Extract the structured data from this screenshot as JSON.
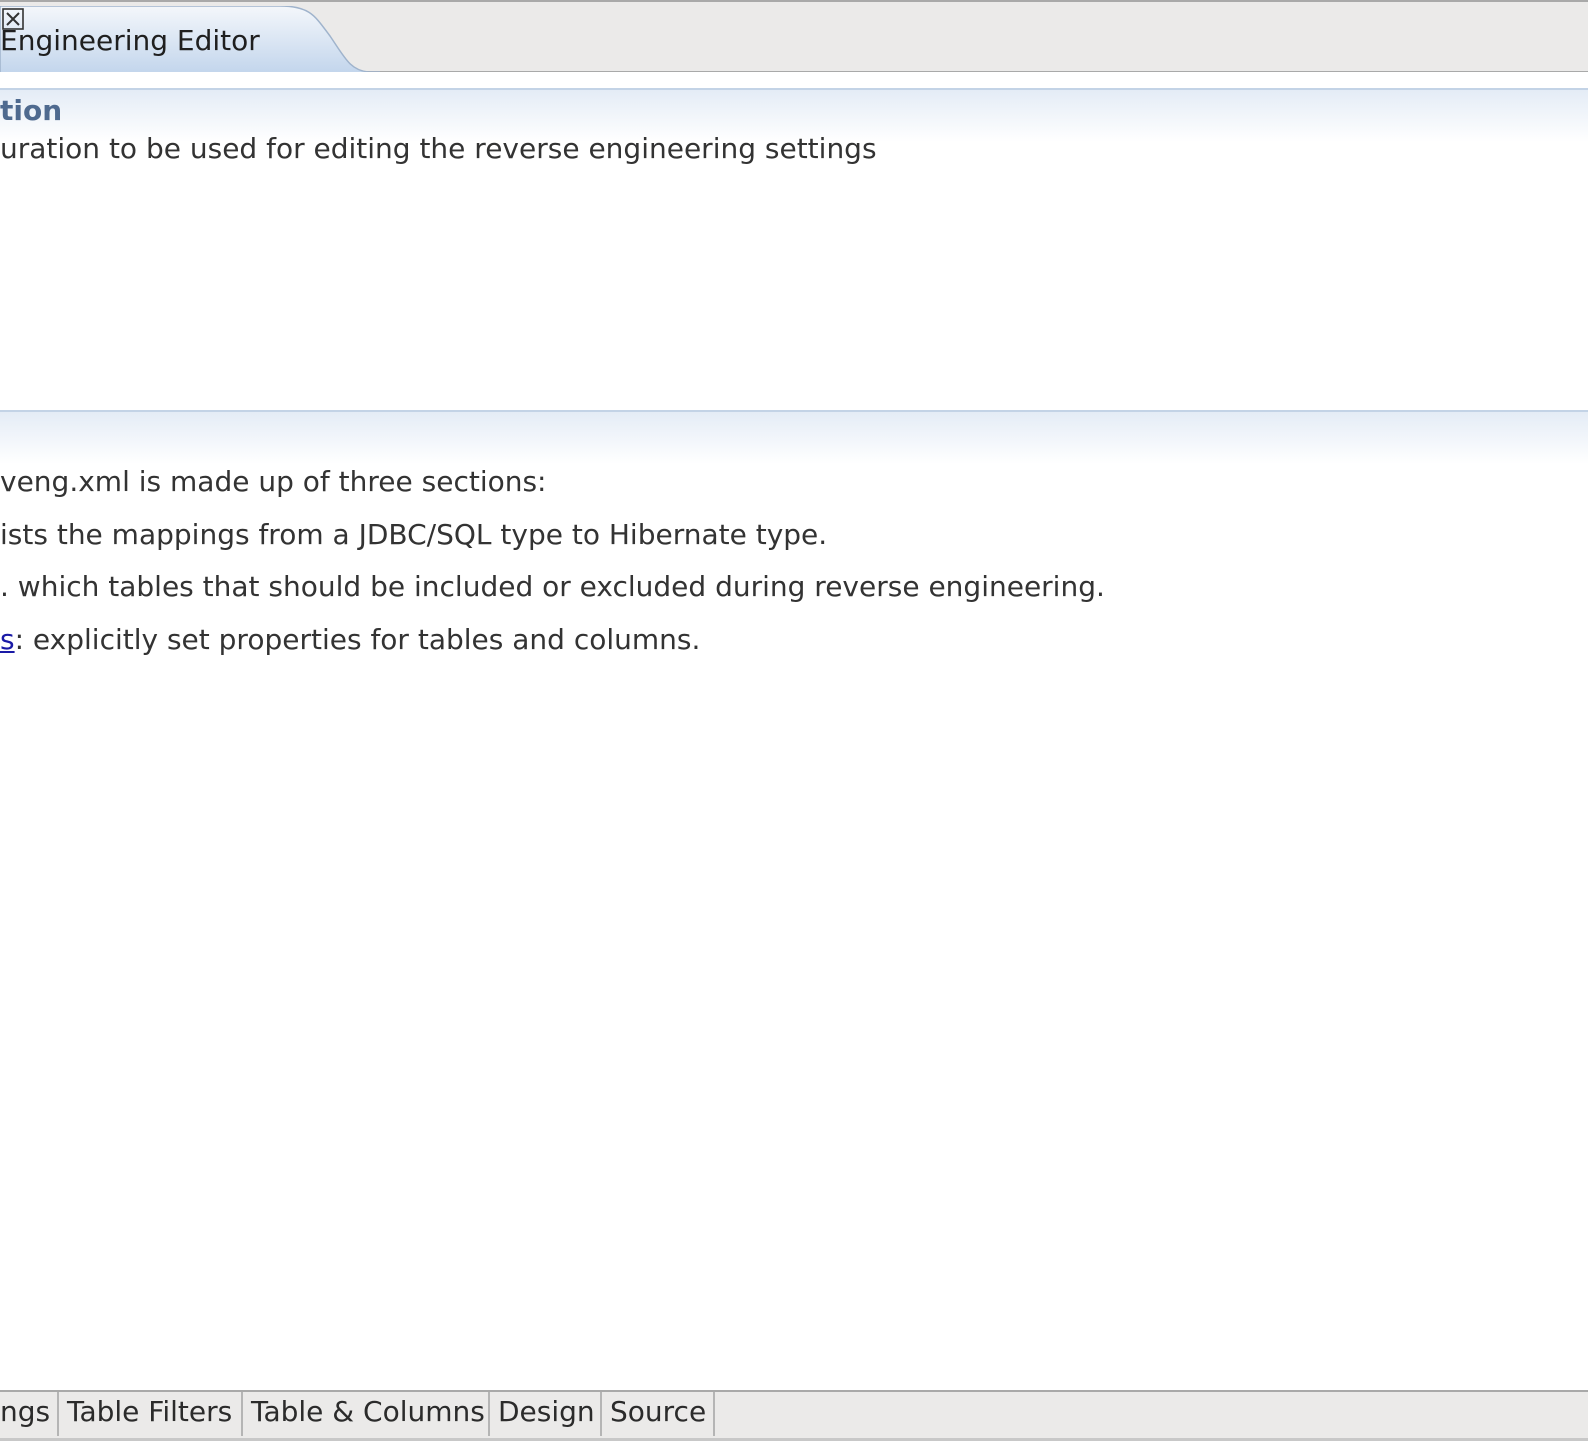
{
  "editor_tab": {
    "label": "Engineering Editor",
    "close_icon": "close-icon"
  },
  "section_configuration": {
    "title": "tion",
    "description": "uration to be used for editing the reverse engineering settings"
  },
  "section_contents": {
    "intro": "veng.xml is made up of three sections:",
    "item1_text": "ists the mappings from a JDBC/SQL type to Hibernate type.",
    "item2_text": ". which tables that should be included or excluded during reverse engineering.",
    "item3_link": "s",
    "item3_text": ": explicitly set properties for tables and columns."
  },
  "page_tabs": {
    "mappings": "ngs",
    "filters": "Table Filters",
    "columns": "Table & Columns",
    "design": "Design",
    "source": "Source"
  },
  "colors": {
    "section_title": "#4f6a8f",
    "section_gradient": "#e4ecf6",
    "link": "#1a1aa6",
    "tab_bar": "#ebeae9"
  }
}
